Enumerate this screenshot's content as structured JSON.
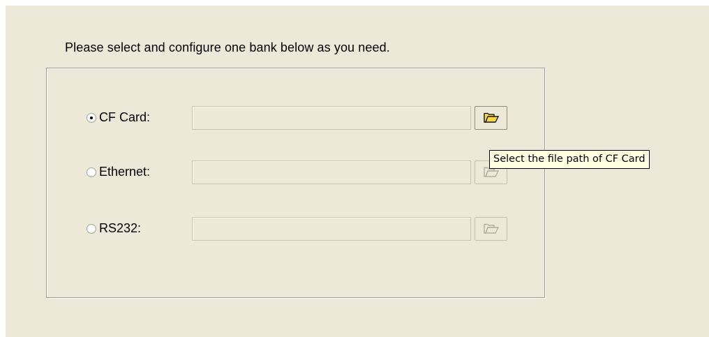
{
  "instruction": "Please select and configure one bank below as you need.",
  "banks": [
    {
      "label": "CF Card:",
      "selected": true,
      "path_value": "",
      "browse_enabled": true,
      "browse_icon": "folder-icon"
    },
    {
      "label": "Ethernet:",
      "selected": false,
      "path_value": "",
      "browse_enabled": false,
      "browse_icon": "folder-icon"
    },
    {
      "label": "RS232:",
      "selected": false,
      "path_value": "",
      "browse_enabled": false,
      "browse_icon": "folder-icon"
    }
  ],
  "tooltip": "Select the file path of CF Card",
  "colors": {
    "dialog_bg": "#ece9d8",
    "tooltip_bg": "#ffffe1",
    "folder_active": "#f5d84a",
    "disabled_gray": "#a9a69a"
  }
}
